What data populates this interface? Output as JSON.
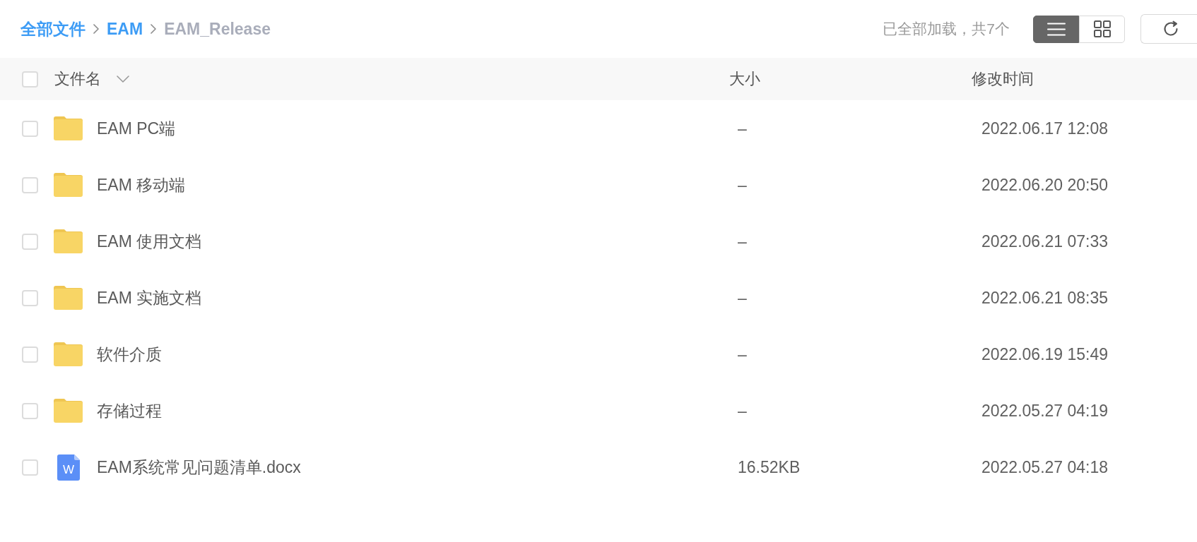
{
  "breadcrumb": [
    {
      "label": "全部文件",
      "current": false
    },
    {
      "label": "EAM",
      "current": false
    },
    {
      "label": "EAM_Release",
      "current": true
    }
  ],
  "load_status": "已全部加载，共7个",
  "view_toggle": [
    {
      "kind": "list",
      "selected": true
    },
    {
      "kind": "grid",
      "selected": false
    }
  ],
  "table": {
    "select_all": {
      "checked": false
    },
    "columns": [
      {
        "label": "文件名",
        "sort_menu": true
      },
      {
        "label": "大小"
      },
      {
        "label": "修改时间"
      }
    ],
    "rows": [
      {
        "kind": "folder",
        "name": "EAM PC端",
        "size": "–",
        "modified": "2022.06.17 12:08",
        "checked": false
      },
      {
        "kind": "folder",
        "name": "EAM 移动端",
        "size": "–",
        "modified": "2022.06.20 20:50",
        "checked": false
      },
      {
        "kind": "folder",
        "name": "EAM 使用文档",
        "size": "–",
        "modified": "2022.06.21 07:33",
        "checked": false
      },
      {
        "kind": "folder",
        "name": "EAM 实施文档",
        "size": "–",
        "modified": "2022.06.21 08:35",
        "checked": false
      },
      {
        "kind": "folder",
        "name": "软件介质",
        "size": "–",
        "modified": "2022.06.19 15:49",
        "checked": false
      },
      {
        "kind": "folder",
        "name": "存储过程",
        "size": "–",
        "modified": "2022.05.27 04:19",
        "checked": false
      },
      {
        "kind": "document",
        "icon_text": "W",
        "name": "EAM系统常见问题清单.docx",
        "size": "16.52KB",
        "modified": "2022.05.27 04:18",
        "checked": false
      }
    ]
  }
}
